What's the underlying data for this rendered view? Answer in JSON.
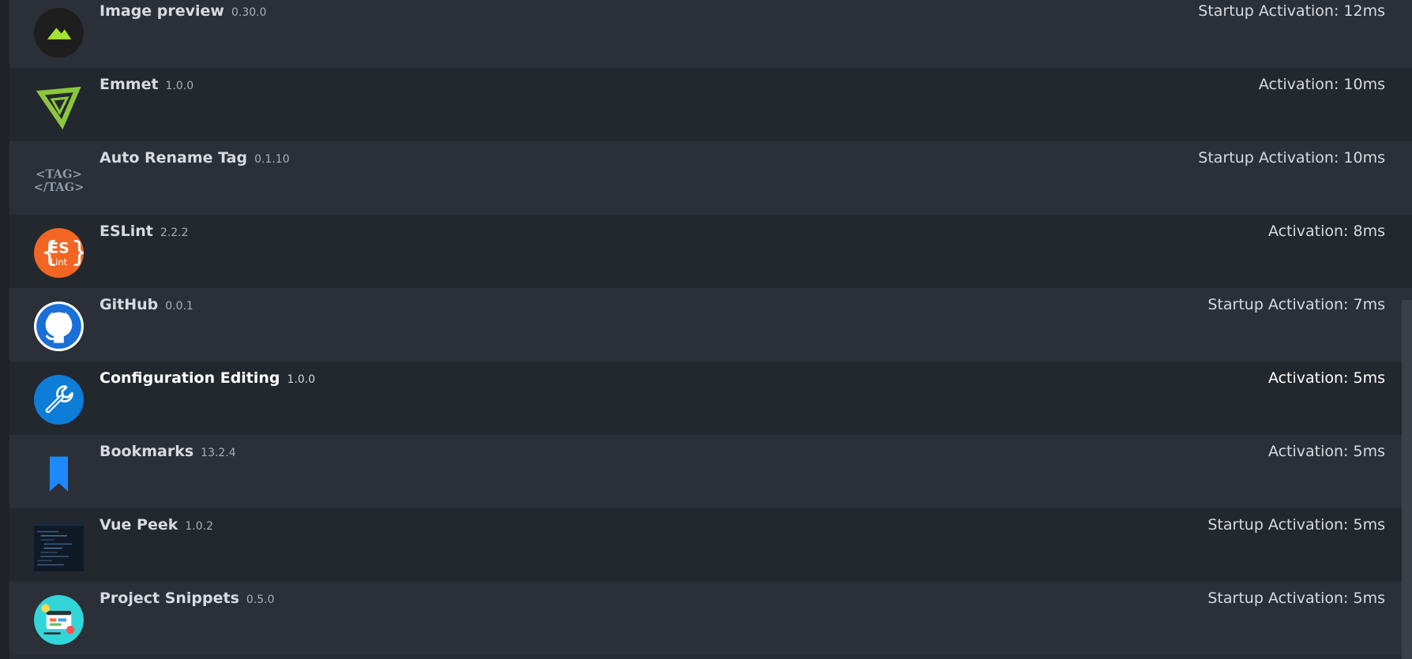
{
  "extensions": [
    {
      "name": "Image preview",
      "version": "0.30.0",
      "activation": "Startup Activation: 12ms",
      "icon": "mountain-icon",
      "color": "#a6e22e"
    },
    {
      "name": "Emmet",
      "version": "1.0.0",
      "activation": "Activation: 10ms",
      "icon": "emmet-icon",
      "color": "#8cc63f"
    },
    {
      "name": "Auto Rename Tag",
      "version": "0.1.10",
      "activation": "Startup Activation: 10ms",
      "icon": "tag-icon",
      "icon_text": [
        "<TAG>",
        "</TAG>"
      ],
      "color": "#8c99a8"
    },
    {
      "name": "ESLint",
      "version": "2.2.2",
      "activation": "Activation: 8ms",
      "icon": "eslint-icon",
      "icon_text": [
        "ES",
        "Lint"
      ],
      "color": "#f26522"
    },
    {
      "name": "GitHub",
      "version": "0.0.1",
      "activation": "Startup Activation: 7ms",
      "icon": "github-icon",
      "color": "#1a6fd8"
    },
    {
      "name": "Configuration Editing",
      "version": "1.0.0",
      "activation": "Activation: 5ms",
      "icon": "wrench-icon",
      "color": "#0d7dd8"
    },
    {
      "name": "Bookmarks",
      "version": "13.2.4",
      "activation": "Activation: 5ms",
      "icon": "bookmark-icon",
      "color": "#1e88ff"
    },
    {
      "name": "Vue Peek",
      "version": "1.0.2",
      "activation": "Startup Activation: 5ms",
      "icon": "code-thumbnail-icon",
      "color": "#0f1a26"
    },
    {
      "name": "Project Snippets",
      "version": "0.5.0",
      "activation": "Startup Activation: 5ms",
      "icon": "snippets-icon",
      "color": "#33d6d8"
    }
  ]
}
